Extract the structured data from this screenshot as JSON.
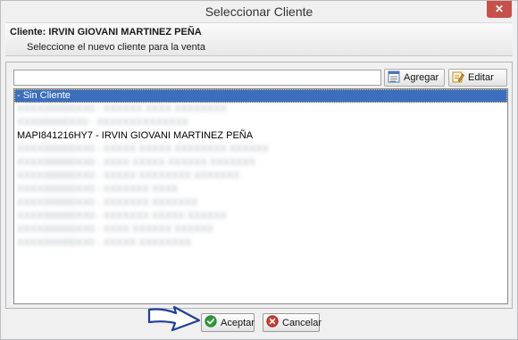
{
  "window": {
    "title": "Seleccionar Cliente",
    "close_glyph": "✕"
  },
  "header": {
    "client_label": "Cliente: IRVIN GIOVANI MARTINEZ PEÑA",
    "subtitle": "Seleccione el nuevo cliente para la venta"
  },
  "search": {
    "value": "",
    "placeholder": ""
  },
  "toolbar": {
    "add_label": "Agregar",
    "add_icon": "form-icon",
    "edit_label": "Editar",
    "edit_icon": "edit-icon"
  },
  "list": {
    "items": [
      {
        "text": "- Sin Cliente",
        "selected": true,
        "blurred": false
      },
      {
        "text": "XXXX000000XX0 - XXXXXX XXXX XXXXXXXX",
        "selected": false,
        "blurred": true
      },
      {
        "text": "XXX000000XX0 - XXXXXXXXXXXXXX",
        "selected": false,
        "blurred": true
      },
      {
        "text": "MAPI841216HY7 - IRVIN GIOVANI MARTINEZ PEÑA",
        "selected": false,
        "blurred": false
      },
      {
        "text": "XXXX000000XX0 - XXXXX XXXXX XXXXXXXX XXXXXX",
        "selected": false,
        "blurred": true
      },
      {
        "text": "XXXX000000XX0 - XXXX XXXXX XXXXXX XXXXXXX",
        "selected": false,
        "blurred": true
      },
      {
        "text": "XXXX000000XX0 - XXXXX XXXXXXXX XXXXXXX",
        "selected": false,
        "blurred": true
      },
      {
        "text": "XXXX000000XX0 - XXXXXXX XXXX",
        "selected": false,
        "blurred": true
      },
      {
        "text": "XXXX000000XX0 - XXXXXXX XXXXXXX",
        "selected": false,
        "blurred": true
      },
      {
        "text": "XXXX000000XX0 - XXXXXXX XXXXX XXXXXX",
        "selected": false,
        "blurred": true
      },
      {
        "text": "XXXX000000XX0 - XXXX XXXXXX XXXXXX",
        "selected": false,
        "blurred": true
      },
      {
        "text": "XXXX000000XX0 - XXXXX XXXXXXXX",
        "selected": false,
        "blurred": true
      }
    ]
  },
  "footer": {
    "accept_label": "Aceptar",
    "accept_icon": "check-icon",
    "cancel_label": "Cancelar",
    "cancel_icon": "cancel-icon"
  },
  "colors": {
    "selection": "#3b6fbd",
    "close_button": "#c7504a",
    "accept_icon": "#2e9a3a",
    "cancel_icon": "#d23a2f"
  }
}
